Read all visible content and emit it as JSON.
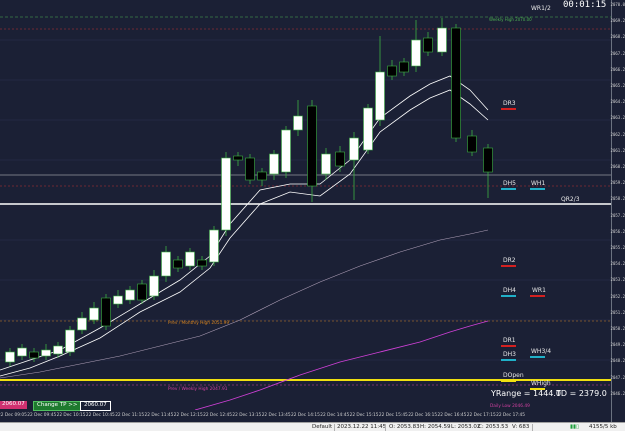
{
  "timer": "00:01:15",
  "weekly_high": "Weekly High 2070.00",
  "levels": [
    {
      "key": "wr12",
      "label": "WR1/2",
      "color": "#e8e8e8",
      "bar": "none"
    },
    {
      "key": "dr3",
      "label": "DR3",
      "color": "#d42020",
      "bar": "red"
    },
    {
      "key": "dh5",
      "label": "DH5",
      "color": "#20b0c8",
      "bar": "cyan"
    },
    {
      "key": "wh1",
      "label": "WH1",
      "color": "#20b0c8",
      "bar": "cyan"
    },
    {
      "key": "qr23",
      "label": "QR2/3",
      "color": "#e8e8e8",
      "bar": "none"
    },
    {
      "key": "dr2",
      "label": "DR2",
      "color": "#d42020",
      "bar": "red"
    },
    {
      "key": "dh4",
      "label": "DH4",
      "color": "#20b0c8",
      "bar": "cyan"
    },
    {
      "key": "wr1",
      "label": "WR1",
      "color": "#d42020",
      "bar": "red"
    },
    {
      "key": "dr1",
      "label": "DR1",
      "color": "#d42020",
      "bar": "red"
    },
    {
      "key": "dh3",
      "label": "DH3",
      "color": "#20b0c8",
      "bar": "cyan"
    },
    {
      "key": "wh34",
      "label": "WH3/4",
      "color": "#20b0c8",
      "bar": "cyan"
    },
    {
      "key": "dopen",
      "label": "DOpen",
      "color": "#e8e8e8",
      "bar": "yellow"
    },
    {
      "key": "whigh",
      "label": "WHigh",
      "color": "#e8e8e8",
      "bar": "yellow"
    }
  ],
  "prev_monthly_high": "Prev / Monthly High 2051.99",
  "prev_weekly_high": "Prev / Weekly High 2047.91",
  "daily_low": "Daily Low 2046.49",
  "yrange": "YRange = 1444.0",
  "td": "TD = 2379.0",
  "price_tag_left": "2060.07",
  "change_tp_button": "Change TP >>",
  "tp_value_field": "2060.07",
  "price_axis": [
    "2070.0",
    "2069.2",
    "2068.2",
    "2067.2",
    "2066.2",
    "2065.2",
    "2064.2",
    "2063.2",
    "2062.2",
    "2061.2",
    "2060.2",
    "2059.2",
    "2058.2",
    "2057.2",
    "2056.2",
    "2055.2",
    "2054.2",
    "2053.2",
    "2052.2",
    "2051.2",
    "2050.2",
    "2049.2",
    "2048.2",
    "2047.2",
    "2046.2"
  ],
  "time_axis": [
    "22 Dec 09:05",
    "22 Dec 09:45",
    "22 Dec 10:15",
    "22 Dec 10:45",
    "22 Dec 11:15",
    "22 Dec 11:45",
    "22 Dec 12:15",
    "22 Dec 12:45",
    "22 Dec 13:15",
    "22 Dec 13:45",
    "22 Dec 14:15",
    "22 Dec 14:45",
    "22 Dec 15:15",
    "22 Dec 15:45",
    "22 Dec 16:15",
    "22 Dec 16:45",
    "22 Dec 17:15",
    "22 Dec 17:45"
  ],
  "status": {
    "profile": "Default",
    "datetime": "2023.12.22 11:45",
    "open": "O: 2053.83",
    "high": "H: 2054.59",
    "low": "L: 2053.02",
    "close": "C: 2053.53",
    "volume": "V: 683",
    "traffic": "4155/5 kb"
  },
  "colors": {
    "background": "#1b2035",
    "bull": "#ffffff",
    "bear": "#000000",
    "wick": "#3cb043",
    "ema_fast": "#ffffff",
    "sma_slow": "#b0a0b8",
    "ma_long": "#d040d8",
    "daily_open": "#f0e010",
    "level_red": "#d42020",
    "level_cyan": "#20b0c8"
  }
}
